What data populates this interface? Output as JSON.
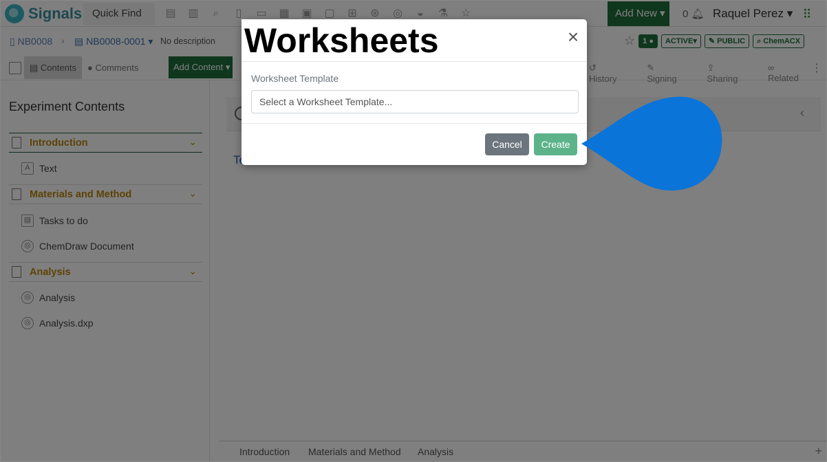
{
  "app": {
    "brand": "Signals",
    "quick_find": "Quick Find",
    "add_new": "Add New",
    "notification_count": "0",
    "user_name": "Raquel Perez",
    "toolbar_icons": [
      "list-icon",
      "bar-chart-icon",
      "search-icon",
      "notebook-icon",
      "clipboard-icon",
      "calendar-icon",
      "image-icon",
      "flask-icon",
      "structure-icon",
      "target-icon",
      "molecule-icon",
      "beaker-icon",
      "star-icon",
      "people-icon"
    ]
  },
  "breadcrumb": {
    "notebook": "NB0008",
    "experiment": "NB0008-0001",
    "description": "No description",
    "comment_count": "1",
    "status": "ACTIVE",
    "visibility": "PUBLIC",
    "chem_acx": "ChemACX"
  },
  "toolbar": {
    "contents": "Contents",
    "comments": "Comments",
    "add_content": "Add Content",
    "history": "History",
    "signing": "Signing",
    "sharing": "Sharing",
    "related": "Related"
  },
  "experiment_contents": {
    "title": "Experiment Contents",
    "sections": [
      {
        "label": "Introduction",
        "items": [
          {
            "label": "Text",
            "icon": "text-icon"
          }
        ]
      },
      {
        "label": "Materials and Method",
        "items": [
          {
            "label": "Tasks to do",
            "icon": "table-icon"
          },
          {
            "label": "ChemDraw Document",
            "icon": "chemdraw-icon"
          }
        ]
      },
      {
        "label": "Analysis",
        "items": [
          {
            "label": "Analysis",
            "icon": "analysis-icon"
          },
          {
            "label": "Analysis.dxp",
            "icon": "analysis-icon"
          }
        ]
      }
    ]
  },
  "main": {
    "text_link": "Te"
  },
  "bottom_tabs": [
    "Introduction",
    "Materials and Method",
    "Analysis"
  ],
  "modal": {
    "title": "Worksheets",
    "field_label": "Worksheet Template",
    "field_placeholder": "Select a Worksheet Template...",
    "cancel_label": "Cancel",
    "create_label": "Create"
  },
  "colors": {
    "brand_green": "#1e6f3c",
    "create_button": "#5cb38a",
    "cancel_button": "#6c757d",
    "section_label": "#b8860b",
    "callout_blue": "#0a74d8"
  }
}
